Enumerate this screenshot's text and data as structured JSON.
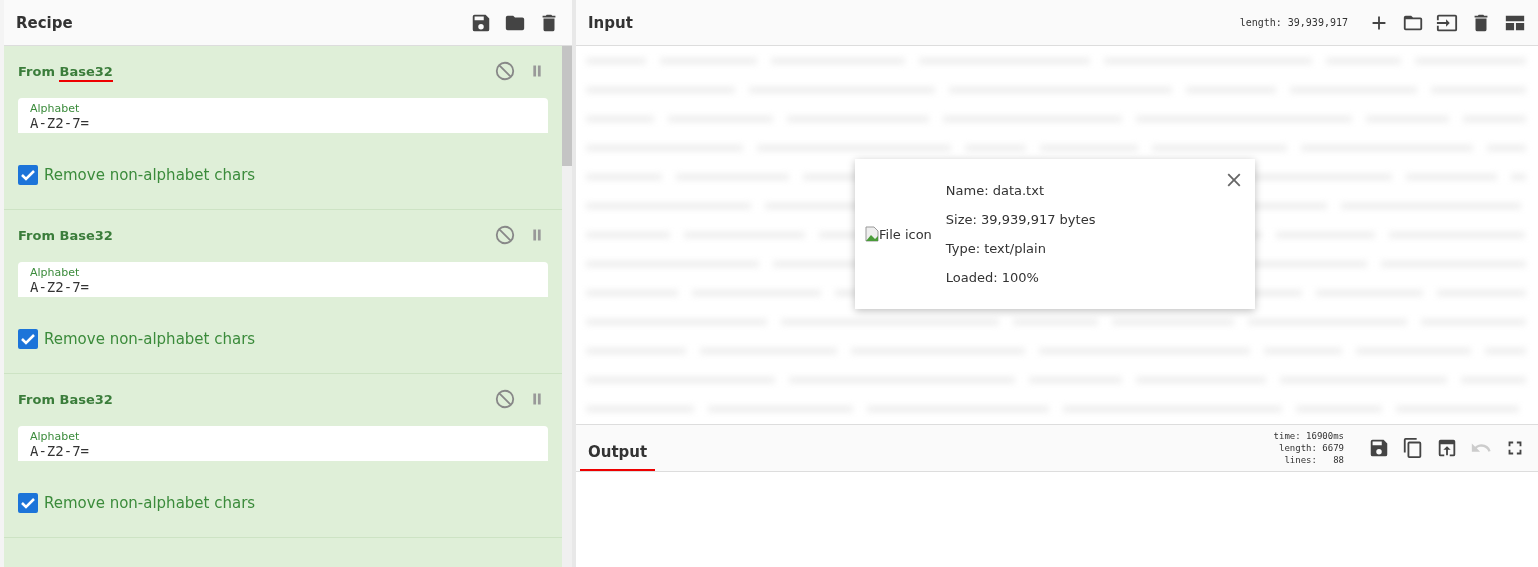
{
  "recipe": {
    "title": "Recipe",
    "operations": [
      {
        "name": "From Base32",
        "highlighted": true,
        "field": {
          "label": "Alphabet",
          "value": "A-Z2-7="
        },
        "option": {
          "label": "Remove non-alphabet chars",
          "checked": true
        }
      },
      {
        "name": "From Base32",
        "highlighted": false,
        "field": {
          "label": "Alphabet",
          "value": "A-Z2-7="
        },
        "option": {
          "label": "Remove non-alphabet chars",
          "checked": true
        }
      },
      {
        "name": "From Base32",
        "highlighted": false,
        "field": {
          "label": "Alphabet",
          "value": "A-Z2-7="
        },
        "option": {
          "label": "Remove non-alphabet chars",
          "checked": true
        }
      }
    ]
  },
  "input": {
    "title": "Input",
    "length": "length: 39,939,917",
    "file": {
      "image_alt": "File icon",
      "details": [
        "Name: data.txt",
        "Size: 39,939,917 bytes",
        "Type: text/plain",
        "Loaded: 100%"
      ]
    }
  },
  "output": {
    "title": "Output",
    "stats": [
      "time: 16900ms",
      "length: 6679",
      "lines:   88"
    ],
    "undo_disabled": true
  }
}
